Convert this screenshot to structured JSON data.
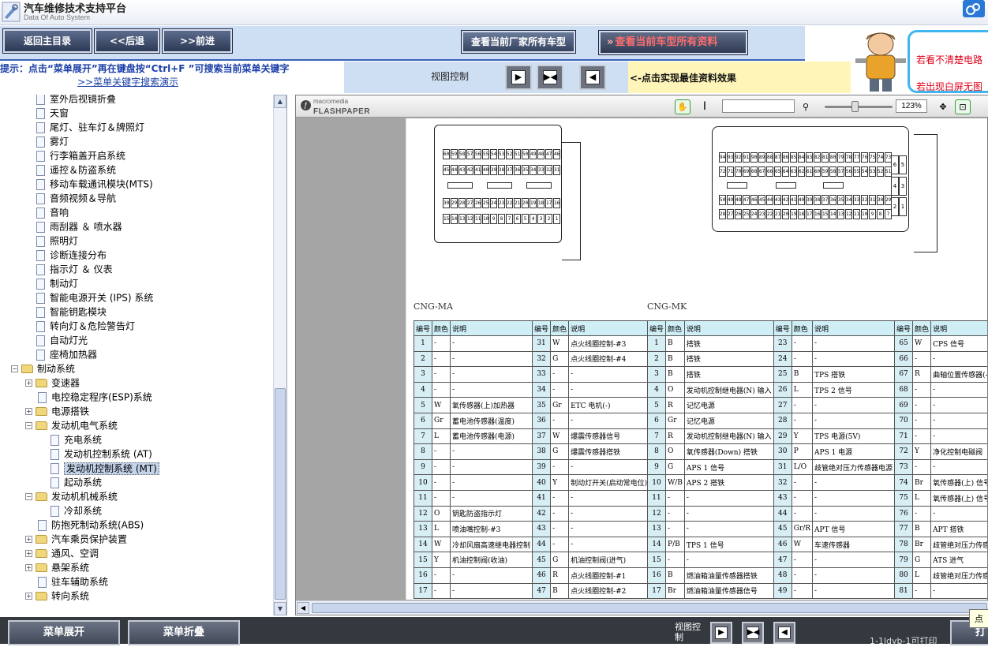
{
  "window": {
    "title": "汽车维修技术支持平台",
    "subtitle": "Data Of Auto System"
  },
  "toolbar": {
    "home": "返回主目录",
    "back": "<<后退",
    "forward": ">>前进",
    "all_models": "查看当前厂家所有车型",
    "all_data": "查看当前车型所有资料"
  },
  "hint": {
    "text": "提示：点击“菜单展开”再在键盘按“Ctrl+F ”可搜索当前菜单关键字",
    "link": ">>菜单关键字搜索演示"
  },
  "view_control": {
    "label": "视图控制",
    "note": "<-点击实现最佳资料效果"
  },
  "notice": {
    "line1": "若看不清楚电路",
    "line2": "若出现白屏无图"
  },
  "tree": [
    {
      "label": "室外后视镜折叠",
      "level": 2,
      "type": "doc"
    },
    {
      "label": "天窗",
      "level": 2,
      "type": "doc"
    },
    {
      "label": "尾灯、驻车灯＆牌照灯",
      "level": 2,
      "type": "doc"
    },
    {
      "label": "雾灯",
      "level": 2,
      "type": "doc"
    },
    {
      "label": "行李箱盖开启系统",
      "level": 2,
      "type": "doc"
    },
    {
      "label": "遥控＆防盗系统",
      "level": 2,
      "type": "doc"
    },
    {
      "label": "移动车载通讯模块(MTS)",
      "level": 2,
      "type": "doc"
    },
    {
      "label": "音频视频＆导航",
      "level": 2,
      "type": "doc"
    },
    {
      "label": "音响",
      "level": 2,
      "type": "doc"
    },
    {
      "label": "雨刮器 ＆ 喷水器",
      "level": 2,
      "type": "doc"
    },
    {
      "label": "照明灯",
      "level": 2,
      "type": "doc"
    },
    {
      "label": "诊断连接分布",
      "level": 2,
      "type": "doc"
    },
    {
      "label": "指示灯 ＆ 仪表",
      "level": 2,
      "type": "doc"
    },
    {
      "label": "制动灯",
      "level": 2,
      "type": "doc"
    },
    {
      "label": "智能电源开关 (IPS) 系统",
      "level": 2,
      "type": "doc"
    },
    {
      "label": "智能钥匙模块",
      "level": 2,
      "type": "doc"
    },
    {
      "label": "转向灯＆危险警告灯",
      "level": 2,
      "type": "doc"
    },
    {
      "label": "自动灯光",
      "level": 2,
      "type": "doc"
    },
    {
      "label": "座椅加热器",
      "level": 2,
      "type": "doc"
    },
    {
      "label": "制动系统",
      "level": 0,
      "type": "folder",
      "toggle": "−"
    },
    {
      "label": "变速器",
      "level": 1,
      "type": "folder",
      "toggle": "+"
    },
    {
      "label": "电控稳定程序(ESP)系统",
      "level": 1,
      "type": "doc"
    },
    {
      "label": "电源搭铁",
      "level": 1,
      "type": "folder",
      "toggle": "+"
    },
    {
      "label": "发动机电气系统",
      "level": 1,
      "type": "folder",
      "toggle": "−"
    },
    {
      "label": "充电系统",
      "level": 2,
      "type": "doc"
    },
    {
      "label": "发动机控制系统 (AT)",
      "level": 2,
      "type": "doc"
    },
    {
      "label": "发动机控制系统 (MT)",
      "level": 2,
      "type": "doc",
      "selected": true
    },
    {
      "label": "起动系统",
      "level": 2,
      "type": "doc"
    },
    {
      "label": "发动机机械系统",
      "level": 1,
      "type": "folder",
      "toggle": "−"
    },
    {
      "label": "冷却系统",
      "level": 2,
      "type": "doc"
    },
    {
      "label": "防抱死制动系统(ABS)",
      "level": 1,
      "type": "doc"
    },
    {
      "label": "汽车乘员保护装置",
      "level": 1,
      "type": "folder",
      "toggle": "+"
    },
    {
      "label": "通风、空调",
      "level": 1,
      "type": "folder",
      "toggle": "+"
    },
    {
      "label": "悬架系统",
      "level": 1,
      "type": "folder",
      "toggle": "+"
    },
    {
      "label": "驻车辅助系统",
      "level": 1,
      "type": "doc"
    },
    {
      "label": "转向系统",
      "level": 1,
      "type": "folder",
      "toggle": "+"
    }
  ],
  "viewer": {
    "brand_small": "macromedia",
    "brand": "FLASHPAPER",
    "zoom": "123%",
    "search_value": ""
  },
  "document": {
    "connector_ma_caption": "CNG-MA",
    "connector_mk_caption": "CNG-MK",
    "ma_pins_top": [
      "60",
      "59",
      "58",
      "57",
      "56",
      "55",
      "54",
      "53",
      "52",
      "51",
      "50",
      "49",
      "48",
      "47",
      "46"
    ],
    "ma_pins_row2": [
      "45",
      "44",
      "43",
      "42",
      "41",
      "40",
      "39",
      "38",
      "37",
      "36",
      "35",
      "34",
      "33",
      "32",
      "31"
    ],
    "ma_pins_row3": [
      "30",
      "29",
      "28",
      "27",
      "26",
      "25",
      "24",
      "23",
      "22",
      "21",
      "20",
      "19",
      "18",
      "17",
      "16"
    ],
    "ma_pins_row4": [
      "15",
      "14",
      "13",
      "12",
      "11",
      "10",
      "9",
      "8",
      "7",
      "6",
      "5",
      "4",
      "3",
      "2",
      "1"
    ],
    "mk_pins_row1": [
      "94",
      "93",
      "92",
      "91",
      "90",
      "89",
      "88",
      "87",
      "86",
      "85",
      "84",
      "83",
      "82",
      "81",
      "80",
      "79",
      "78",
      "77",
      "76",
      "75",
      "74",
      "73"
    ],
    "mk_pins_row2": [
      "72",
      "71",
      "70",
      "69",
      "68",
      "67",
      "66",
      "65",
      "64",
      "63",
      "62",
      "61",
      "60",
      "59",
      "58",
      "57",
      "56",
      "55",
      "54",
      "53",
      "52",
      "51"
    ],
    "mk_pins_row3": [
      "50",
      "49",
      "48",
      "47",
      "46",
      "45",
      "44",
      "43",
      "42",
      "41",
      "40",
      "39",
      "38",
      "37",
      "36",
      "35",
      "34",
      "33",
      "32",
      "31",
      "30",
      "29"
    ],
    "mk_pins_row4": [
      "28",
      "27",
      "26",
      "25",
      "24",
      "23",
      "22",
      "21",
      "20",
      "19",
      "18",
      "17",
      "16",
      "15",
      "14",
      "13",
      "12",
      "11",
      "10",
      "9",
      "8",
      "7"
    ],
    "mk_side_pins": [
      "6",
      "5",
      "4",
      "3",
      "2",
      "1"
    ],
    "headers": {
      "num": "编号",
      "color": "颜色",
      "desc": "说明"
    },
    "ma_left": [
      [
        "1",
        "-",
        "-"
      ],
      [
        "2",
        "-",
        "-"
      ],
      [
        "3",
        "-",
        "-"
      ],
      [
        "4",
        "-",
        "-"
      ],
      [
        "5",
        "W",
        "氧传感器(上)加热器"
      ],
      [
        "6",
        "Gr",
        "蓄电池传感器(温度)"
      ],
      [
        "7",
        "L",
        "蓄电池传感器(电源)"
      ],
      [
        "8",
        "-",
        "-"
      ],
      [
        "9",
        "-",
        "-"
      ],
      [
        "10",
        "-",
        "-"
      ],
      [
        "11",
        "-",
        "-"
      ],
      [
        "12",
        "O",
        "钥匙防盗指示灯"
      ],
      [
        "13",
        "L",
        "喷油嘴控制-#3"
      ],
      [
        "14",
        "W",
        "冷却风扇高速继电器控制"
      ],
      [
        "15",
        "Y",
        "机油控制阀(收油)"
      ],
      [
        "16",
        "-",
        "-"
      ],
      [
        "17",
        "-",
        "-"
      ]
    ],
    "ma_right": [
      [
        "31",
        "W",
        "点火线圈控制-#3"
      ],
      [
        "32",
        "G",
        "点火线圈控制-#4"
      ],
      [
        "33",
        "-",
        "-"
      ],
      [
        "34",
        "-",
        "-"
      ],
      [
        "35",
        "Gr",
        "ETC 电机(-)"
      ],
      [
        "36",
        "-",
        "-"
      ],
      [
        "37",
        "W",
        "爆震传感器信号"
      ],
      [
        "38",
        "G",
        "爆震传感器搭铁"
      ],
      [
        "39",
        "-",
        "-"
      ],
      [
        "40",
        "Y",
        "制动灯开关(启动常电位)"
      ],
      [
        "41",
        "-",
        "-"
      ],
      [
        "42",
        "-",
        "-"
      ],
      [
        "43",
        "-",
        "-"
      ],
      [
        "44",
        "-",
        "-"
      ],
      [
        "45",
        "G",
        "机油控制阀(进气)"
      ],
      [
        "46",
        "R",
        "点火线圈控制-#1"
      ],
      [
        "47",
        "B",
        "点火线圈控制-#2"
      ]
    ],
    "mk_col1": [
      [
        "1",
        "B",
        "搭铁"
      ],
      [
        "2",
        "B",
        "搭铁"
      ],
      [
        "3",
        "B",
        "搭铁"
      ],
      [
        "4",
        "O",
        "发动机控制继电器(N) 输入"
      ],
      [
        "5",
        "R",
        "记忆电源"
      ],
      [
        "6",
        "Gr",
        "记忆电源"
      ],
      [
        "7",
        "R",
        "发动机控制继电器(N) 输入"
      ],
      [
        "8",
        "O",
        "氧传感器(Down) 搭铁"
      ],
      [
        "9",
        "G",
        "APS 1 信号"
      ],
      [
        "10",
        "W/B",
        "APS 2 搭铁"
      ],
      [
        "11",
        "-",
        "-"
      ],
      [
        "12",
        "-",
        "-"
      ],
      [
        "13",
        "-",
        "-"
      ],
      [
        "14",
        "P/B",
        "TPS 1 信号"
      ],
      [
        "15",
        "-",
        "-"
      ],
      [
        "16",
        "B",
        "燃油箱油量传感器搭铁"
      ],
      [
        "17",
        "Br",
        "燃油箱油量传感器信号"
      ]
    ],
    "mk_col2": [
      [
        "23",
        "-",
        "-"
      ],
      [
        "24",
        "-",
        "-"
      ],
      [
        "25",
        "B",
        "TPS 搭铁"
      ],
      [
        "26",
        "L",
        "TPS 2 信号"
      ],
      [
        "27",
        "-",
        "-"
      ],
      [
        "28",
        "-",
        "-"
      ],
      [
        "29",
        "Y",
        "TPS 电源(5V)"
      ],
      [
        "30",
        "P",
        "APS 1 电源"
      ],
      [
        "31",
        "L/O",
        "歧管绝对压力传感器电源"
      ],
      [
        "32",
        "-",
        "-"
      ],
      [
        "43",
        "-",
        "-"
      ],
      [
        "44",
        "-",
        "-"
      ],
      [
        "45",
        "Gr/R",
        "APT 信号"
      ],
      [
        "46",
        "W",
        "车速传感器"
      ],
      [
        "47",
        "-",
        "-"
      ],
      [
        "48",
        "-",
        "-"
      ],
      [
        "49",
        "-",
        "-"
      ]
    ],
    "mk_col3": [
      [
        "65",
        "W",
        "CPS 信号"
      ],
      [
        "66",
        "-",
        "-"
      ],
      [
        "67",
        "R",
        "曲轴位置传感器(-)"
      ],
      [
        "68",
        "-",
        "-"
      ],
      [
        "69",
        "-",
        "-"
      ],
      [
        "70",
        "-",
        "-"
      ],
      [
        "71",
        "-",
        "-"
      ],
      [
        "72",
        "Y",
        "净化控制电磁阀"
      ],
      [
        "73",
        "-",
        "-"
      ],
      [
        "74",
        "Br",
        "氧传感器(上) 信号"
      ],
      [
        "75",
        "L",
        "氧传感器(上) 信号"
      ],
      [
        "76",
        "-",
        "-"
      ],
      [
        "77",
        "B",
        "APT 搭铁"
      ],
      [
        "78",
        "Br",
        "歧管绝对压力传感器搭铁"
      ],
      [
        "79",
        "G",
        "ATS 进气"
      ],
      [
        "80",
        "L",
        "歧管绝对压力传感器信号"
      ],
      [
        "81",
        "-",
        "-"
      ]
    ]
  },
  "bottom": {
    "expand": "菜单展开",
    "collapse": "菜单折叠",
    "view_label": "视图控制",
    "page_info": "1-1ldyb-1可打印",
    "print": "打",
    "tooltip": "点"
  }
}
